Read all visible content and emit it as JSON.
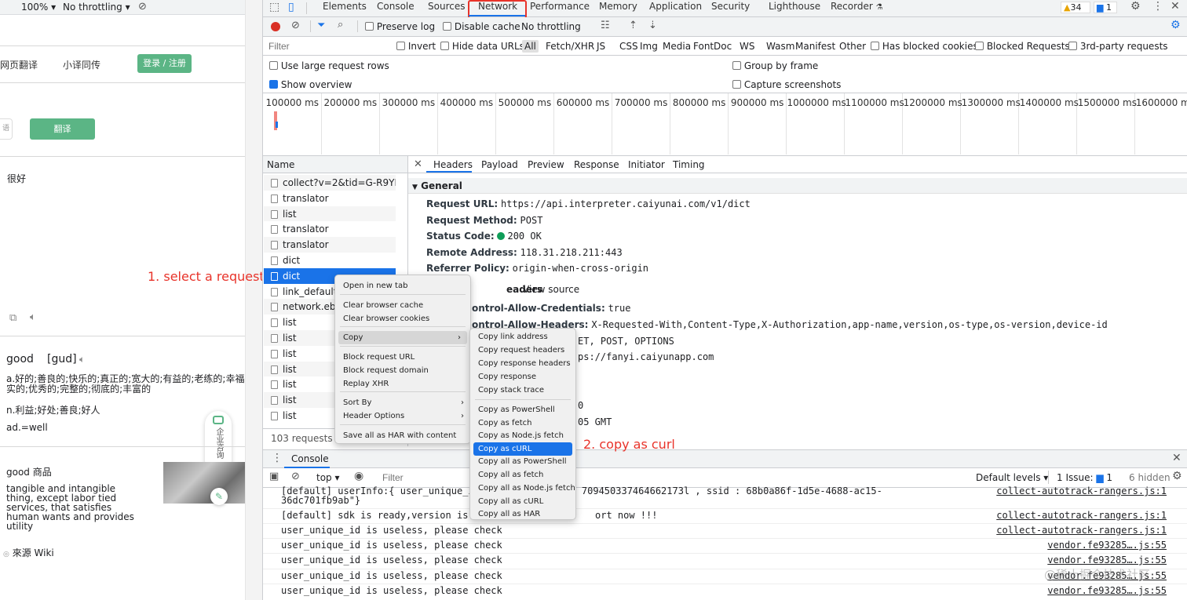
{
  "browser_bar": {
    "zoom": "100%",
    "throttling": "No throttling"
  },
  "web": {
    "nav": [
      "网页翻译",
      "小译同传"
    ],
    "login": "登录 / 注册",
    "lang_chip": "语",
    "translate_btn": "翻译",
    "input_text": "很好",
    "word": "good",
    "phonetic": "[gud]",
    "def1": "a.好的;善良的;快乐的;真正的;宽大的;有益的;老练的;幸福实的;优秀的;完整的;彻底的;丰富的",
    "def2": "n.利益;好处;善良;好人",
    "def3": "ad.=well",
    "goods_title": "good 商品",
    "goods_desc": "tangible and intangible thing, except labor tied services, that satisfies human wants and provides utility",
    "source": "來源 Wiki",
    "float_btn": "企业咨询"
  },
  "annotations": {
    "step1": "1. select a request",
    "step2": "2. copy as curl"
  },
  "devtools": {
    "tabs": [
      "Elements",
      "Console",
      "Sources",
      "Network",
      "Performance",
      "Memory",
      "Application",
      "Security",
      "Lighthouse",
      "Recorder"
    ],
    "active_tab": "Network",
    "warnings": "34",
    "messages": "1",
    "toolbar": {
      "preserve_log": "Preserve log",
      "disable_cache": "Disable cache",
      "throttling": "No throttling"
    },
    "filter": {
      "placeholder": "Filter",
      "invert": "Invert",
      "hide_data_urls": "Hide data URLs",
      "types": [
        "All",
        "Fetch/XHR",
        "JS",
        "CSS",
        "Img",
        "Media",
        "Font",
        "Doc",
        "WS",
        "Wasm",
        "Manifest",
        "Other"
      ],
      "blocked_cookies": "Has blocked cookies",
      "blocked_requests": "Blocked Requests",
      "third_party": "3rd-party requests"
    },
    "options": {
      "large_rows": "Use large request rows",
      "show_overview": "Show overview",
      "group_by_frame": "Group by frame",
      "capture_screenshots": "Capture screenshots"
    },
    "timeline": [
      "100000 ms",
      "200000 ms",
      "300000 ms",
      "400000 ms",
      "500000 ms",
      "600000 ms",
      "700000 ms",
      "800000 ms",
      "900000 ms",
      "1000000 ms",
      "1100000 ms",
      "1200000 ms",
      "1300000 ms",
      "1400000 ms",
      "1500000 ms",
      "1600000 ms"
    ],
    "name_header": "Name",
    "requests": [
      "collect?v=2&tid=G-R9YP...",
      "translator",
      "list",
      "translator",
      "translator",
      "dict",
      "dict",
      "link_default_i",
      "network.eb2a",
      "list",
      "list",
      "list",
      "list",
      "list",
      "list",
      "list"
    ],
    "selected_request": "dict",
    "request_count": "103 requests",
    "detail_tabs": [
      "Headers",
      "Payload",
      "Preview",
      "Response",
      "Initiator",
      "Timing"
    ],
    "general_title": "General",
    "general": [
      {
        "k": "Request URL:",
        "v": "https://api.interpreter.caiyunai.com/v1/dict"
      },
      {
        "k": "Request Method:",
        "v": "POST"
      },
      {
        "k": "Status Code:",
        "v": "200 OK"
      },
      {
        "k": "Remote Address:",
        "v": "118.31.218.211:443"
      },
      {
        "k": "Referrer Policy:",
        "v": "origin-when-cross-origin"
      }
    ],
    "response_headers_title": "eaders",
    "view_source": "View source",
    "response_headers": [
      {
        "k": "ontrol-Allow-Credentials:",
        "v": "true"
      },
      {
        "k": "ontrol-Allow-Headers:",
        "v": "X-Requested-With,Content-Type,X-Authorization,app-name,version,os-type,os-version,device-id"
      },
      {
        "k": "",
        "v": "ET, POST, OPTIONS"
      },
      {
        "k": "",
        "v": "ps://fanyi.caiyunapp.com"
      },
      {
        "k": "",
        "v": "0"
      },
      {
        "k": "",
        "v": "05 GMT"
      }
    ],
    "context_menu": [
      "Open in new tab",
      "Clear browser cache",
      "Clear browser cookies",
      "Copy",
      "Block request URL",
      "Block request domain",
      "Replay XHR",
      "Sort By",
      "Header Options",
      "Save all as HAR with content"
    ],
    "copy_submenu": [
      "Copy link address",
      "Copy request headers",
      "Copy response headers",
      "Copy response",
      "Copy stack trace",
      "Copy as PowerShell",
      "Copy as fetch",
      "Copy as Node.js fetch",
      "Copy as cURL",
      "Copy all as PowerShell",
      "Copy all as fetch",
      "Copy all as Node.js fetch",
      "Copy all as cURL",
      "Copy all as HAR"
    ],
    "console": {
      "tab": "Console",
      "context": "top",
      "filter_placeholder": "Filter",
      "levels": "Default levels",
      "issues": "1 Issue:",
      "issues_count": "1",
      "hidden": "6 hidden",
      "lines": [
        {
          "text": "[default] userInfo:{ user_unique_id  ...31 , web_id : 709450337464662173l , ssid : 68b0a86f-1d5e-4688-ac15-",
          "src": "collect-autotrack-rangers.js:1"
        },
        {
          "text": "36dc701fb9ab\"}",
          "src": ""
        },
        {
          "text": "[default] sdk is ready,version is 4",
          "text2": "ort now !!!",
          "src": "collect-autotrack-rangers.js:1"
        },
        {
          "text": "user_unique_id is useless, please check",
          "src": "collect-autotrack-rangers.js:1"
        },
        {
          "text": "user_unique_id is useless, please check",
          "src": "vendor.fe93285….js:55"
        },
        {
          "text": "user_unique_id is useless, please check",
          "src": "vendor.fe93285….js:55"
        },
        {
          "text": "user_unique_id is useless, please check",
          "src": "vendor.fe93285….js:55"
        },
        {
          "text": "user_unique_id is useless, please check",
          "src": "vendor.fe93285….js:55"
        }
      ]
    },
    "watermark": "@稀土掘金技术社区"
  },
  "colors": {
    "accent": "#1a73e8",
    "annotation": "#e8332a",
    "green": "#5bb585",
    "selected_row": "#1a73e8"
  }
}
